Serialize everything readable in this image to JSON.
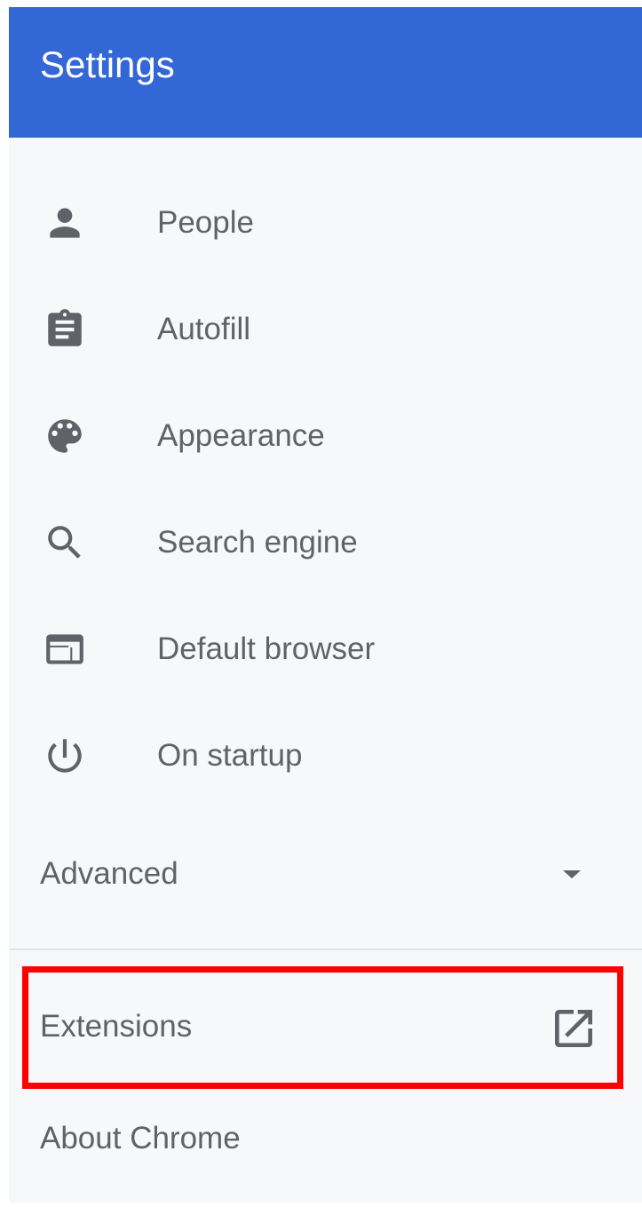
{
  "header": {
    "title": "Settings"
  },
  "nav": {
    "items": [
      {
        "label": "People",
        "icon": "person-icon"
      },
      {
        "label": "Autofill",
        "icon": "clipboard-icon"
      },
      {
        "label": "Appearance",
        "icon": "palette-icon"
      },
      {
        "label": "Search engine",
        "icon": "search-icon"
      },
      {
        "label": "Default browser",
        "icon": "browser-window-icon"
      },
      {
        "label": "On startup",
        "icon": "power-icon"
      }
    ]
  },
  "advanced": {
    "label": "Advanced",
    "icon": "caret-down-icon"
  },
  "extensions": {
    "label": "Extensions",
    "icon": "open-in-new-icon"
  },
  "about": {
    "label": "About Chrome"
  },
  "colors": {
    "header_bg": "#3367d6",
    "panel_bg": "#f7f8fa",
    "text": "#5f6368",
    "icon": "#5f6368",
    "highlight": "#ff0000"
  }
}
